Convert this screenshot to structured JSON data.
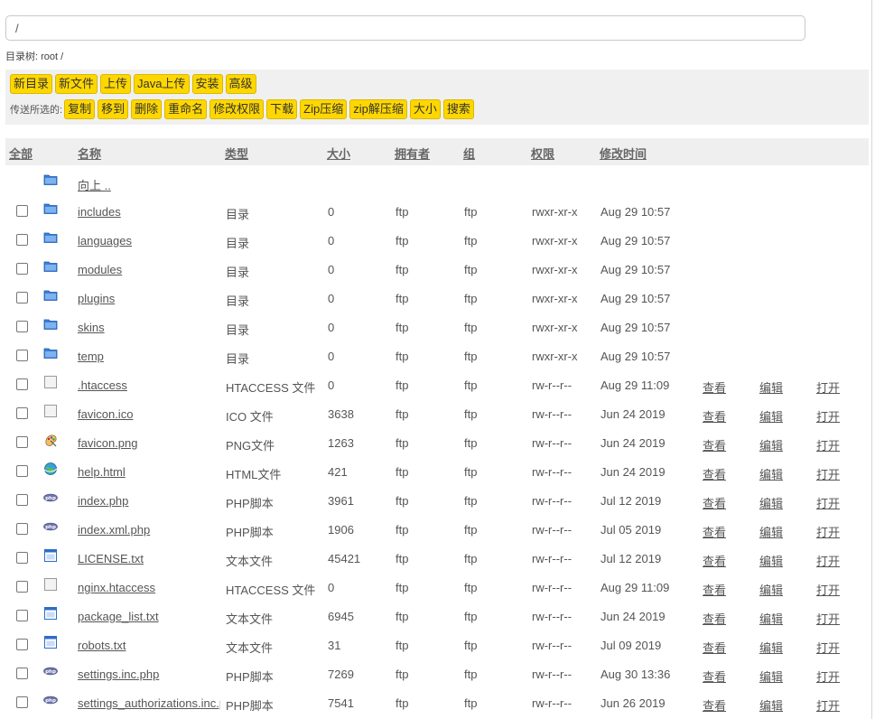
{
  "path": {
    "value": "/"
  },
  "dir_tree": {
    "text": "目录树: root /"
  },
  "toolbar": {
    "row1": [
      "新目录",
      "新文件",
      "上传",
      "Java上传",
      "安装",
      "高级"
    ],
    "pass_label": "传送所选的:",
    "row2": [
      "复制",
      "移到",
      "删除",
      "重命名",
      "修改权限",
      "下载",
      "Zip压缩",
      "zip解压缩",
      "大小",
      "搜索"
    ]
  },
  "columns": {
    "all": "全部",
    "name": "名称",
    "type": "类型",
    "size": "大小",
    "owner": "拥有者",
    "group": "组",
    "perms": "权限",
    "mtime": "修改时间"
  },
  "actions": {
    "view": "查看",
    "edit": "编辑",
    "open": "打开"
  },
  "colors": {
    "button": "#ffd700",
    "header_bg": "#efefef",
    "toolbar_bg": "#f0f0f0",
    "folder": "#3d7ed6"
  },
  "up_row": {
    "name": "向上 ..",
    "icon": "folder-icon"
  },
  "files": [
    {
      "name": "includes",
      "type": "目录",
      "size": "0",
      "owner": "ftp",
      "group": "ftp",
      "perms": "rwxr-xr-x",
      "mtime": "Aug 29 10:57",
      "icon": "folder-icon",
      "actions": false
    },
    {
      "name": "languages",
      "type": "目录",
      "size": "0",
      "owner": "ftp",
      "group": "ftp",
      "perms": "rwxr-xr-x",
      "mtime": "Aug 29 10:57",
      "icon": "folder-icon",
      "actions": false
    },
    {
      "name": "modules",
      "type": "目录",
      "size": "0",
      "owner": "ftp",
      "group": "ftp",
      "perms": "rwxr-xr-x",
      "mtime": "Aug 29 10:57",
      "icon": "folder-icon",
      "actions": false
    },
    {
      "name": "plugins",
      "type": "目录",
      "size": "0",
      "owner": "ftp",
      "group": "ftp",
      "perms": "rwxr-xr-x",
      "mtime": "Aug 29 10:57",
      "icon": "folder-icon",
      "actions": false
    },
    {
      "name": "skins",
      "type": "目录",
      "size": "0",
      "owner": "ftp",
      "group": "ftp",
      "perms": "rwxr-xr-x",
      "mtime": "Aug 29 10:57",
      "icon": "folder-icon",
      "actions": false
    },
    {
      "name": "temp",
      "type": "目录",
      "size": "0",
      "owner": "ftp",
      "group": "ftp",
      "perms": "rwxr-xr-x",
      "mtime": "Aug 29 10:57",
      "icon": "folder-icon",
      "actions": false
    },
    {
      "name": ".htaccess",
      "type": "HTACCESS 文件",
      "size": "0",
      "owner": "ftp",
      "group": "ftp",
      "perms": "rw-r--r--",
      "mtime": "Aug 29 11:09",
      "icon": "blank-file-icon",
      "actions": true
    },
    {
      "name": "favicon.ico",
      "type": "ICO 文件",
      "size": "3638",
      "owner": "ftp",
      "group": "ftp",
      "perms": "rw-r--r--",
      "mtime": "Jun 24 2019",
      "icon": "blank-file-icon",
      "actions": true
    },
    {
      "name": "favicon.png",
      "type": "PNG文件",
      "size": "1263",
      "owner": "ftp",
      "group": "ftp",
      "perms": "rw-r--r--",
      "mtime": "Jun 24 2019",
      "icon": "image-file-icon",
      "actions": true
    },
    {
      "name": "help.html",
      "type": "HTML文件",
      "size": "421",
      "owner": "ftp",
      "group": "ftp",
      "perms": "rw-r--r--",
      "mtime": "Jun 24 2019",
      "icon": "html-globe-icon",
      "actions": true
    },
    {
      "name": "index.php",
      "type": "PHP脚本",
      "size": "3961",
      "owner": "ftp",
      "group": "ftp",
      "perms": "rw-r--r--",
      "mtime": "Jul 12 2019",
      "icon": "php-file-icon",
      "actions": true
    },
    {
      "name": "index.xml.php",
      "type": "PHP脚本",
      "size": "1906",
      "owner": "ftp",
      "group": "ftp",
      "perms": "rw-r--r--",
      "mtime": "Jul 05 2019",
      "icon": "php-file-icon",
      "actions": true
    },
    {
      "name": "LICENSE.txt",
      "type": "文本文件",
      "size": "45421",
      "owner": "ftp",
      "group": "ftp",
      "perms": "rw-r--r--",
      "mtime": "Jul 12 2019",
      "icon": "text-file-icon",
      "actions": true
    },
    {
      "name": "nginx.htaccess",
      "type": "HTACCESS 文件",
      "size": "0",
      "owner": "ftp",
      "group": "ftp",
      "perms": "rw-r--r--",
      "mtime": "Aug 29 11:09",
      "icon": "blank-file-icon",
      "actions": true
    },
    {
      "name": "package_list.txt",
      "type": "文本文件",
      "size": "6945",
      "owner": "ftp",
      "group": "ftp",
      "perms": "rw-r--r--",
      "mtime": "Jun 24 2019",
      "icon": "text-file-icon",
      "actions": true
    },
    {
      "name": "robots.txt",
      "type": "文本文件",
      "size": "31",
      "owner": "ftp",
      "group": "ftp",
      "perms": "rw-r--r--",
      "mtime": "Jul 09 2019",
      "icon": "text-file-icon",
      "actions": true
    },
    {
      "name": "settings.inc.php",
      "type": "PHP脚本",
      "size": "7269",
      "owner": "ftp",
      "group": "ftp",
      "perms": "rw-r--r--",
      "mtime": "Aug 30 13:36",
      "icon": "php-file-icon",
      "actions": true
    },
    {
      "name": "settings_authorizations.inc.php",
      "type": "PHP脚本",
      "size": "7541",
      "owner": "ftp",
      "group": "ftp",
      "perms": "rw-r--r--",
      "mtime": "Jun 26 2019",
      "icon": "php-file-icon",
      "actions": true
    }
  ]
}
